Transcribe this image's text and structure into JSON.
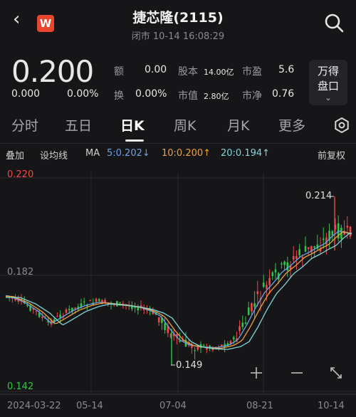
{
  "header": {
    "title": "捷芯隆(2115)",
    "status": "闭市 10-14 16:08:29",
    "back_icon": "chevron-left-icon",
    "logo_text": "W",
    "search_icon": "search-icon"
  },
  "quote": {
    "price": "0.200",
    "change": "0.000",
    "change_pct": "0.00%",
    "stats": [
      {
        "label": "额",
        "value": "0.00"
      },
      {
        "label": "股本",
        "value": "14.00亿"
      },
      {
        "label": "市盈",
        "value": "5.6"
      },
      {
        "label": "换",
        "value": "0.00%"
      },
      {
        "label": "市值",
        "value": "2.80亿"
      },
      {
        "label": "市净",
        "value": "0.76"
      }
    ],
    "wande_button": [
      "万得",
      "盘口"
    ]
  },
  "tabs": [
    "分时",
    "五日",
    "日K",
    "周K",
    "月K",
    "更多"
  ],
  "active_tab": "日K",
  "toolbar": {
    "overlay": "叠加",
    "drawing": "设均线",
    "ma_label": "MA",
    "ma5": "5:0.202↓",
    "ma10": "10:0.200↑",
    "ma20": "20:0.194↑",
    "adjust": "前复权",
    "ma5_color": "#6aa3e8",
    "ma10_color": "#f0a23c",
    "ma20_color": "#7fd6d8"
  },
  "colors": {
    "up": "#f04848",
    "down": "#2fc44a",
    "bg": "#161618"
  },
  "chart_data": {
    "type": "candlestick",
    "y_top_label": "0.220",
    "y_mid_label": "0.182",
    "y_bottom_label": "0.142",
    "ylim": [
      0.142,
      0.22
    ],
    "x_labels": [
      "2024-03-22",
      "05-14",
      "07-04",
      "08-21",
      "10-14"
    ],
    "annotations": [
      {
        "text": "0.214",
        "value": 0.214
      },
      {
        "text": "0.149",
        "value": 0.149
      }
    ],
    "controls": [
      "zoom-in-icon",
      "zoom-out-icon",
      "expand-icon"
    ]
  }
}
